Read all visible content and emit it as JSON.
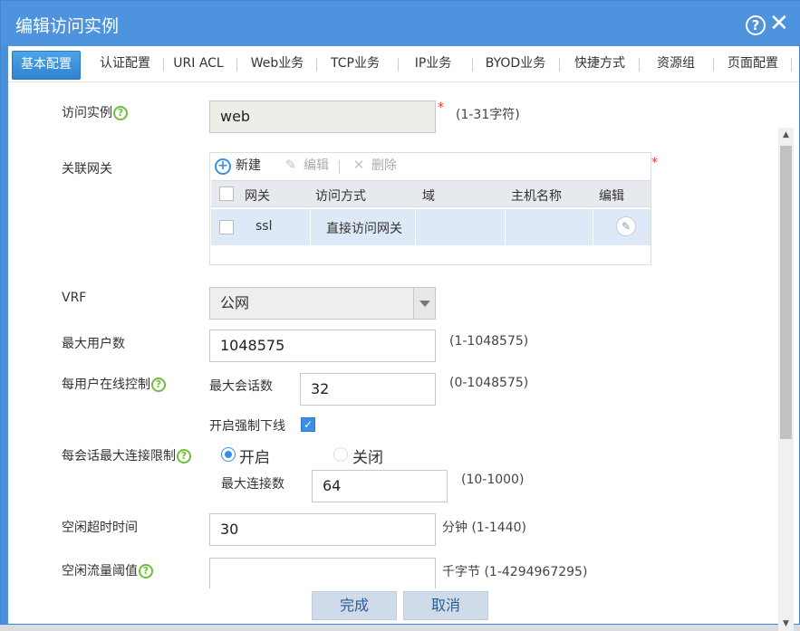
{
  "window": {
    "title": "编辑访问实例",
    "help_glyph": "?",
    "close_glyph": "✕"
  },
  "tabs": [
    {
      "label": "基本配置",
      "active": true
    },
    {
      "label": "认证配置"
    },
    {
      "label": "URI ACL"
    },
    {
      "label": "Web业务"
    },
    {
      "label": "TCP业务"
    },
    {
      "label": "IP业务"
    },
    {
      "label": "BYOD业务"
    },
    {
      "label": "快捷方式"
    },
    {
      "label": "资源组"
    },
    {
      "label": "页面配置"
    }
  ],
  "form": {
    "instance": {
      "label": "访问实例",
      "value": "web",
      "required_mark": "*",
      "hint": "(1-31字符)"
    },
    "gateway": {
      "label": "关联网关",
      "required_mark": "*",
      "toolbar": {
        "new": "新建",
        "edit": "编辑",
        "delete": "删除"
      },
      "columns": [
        "网关",
        "访问方式",
        "域",
        "主机名称",
        "编辑"
      ],
      "rows": [
        {
          "gateway": "ssl",
          "access_mode": "直接访问网关",
          "domain": "",
          "hostname": ""
        }
      ]
    },
    "vrf": {
      "label": "VRF",
      "value": "公网"
    },
    "max_users": {
      "label": "最大用户数",
      "value": "1048575",
      "hint": "(1-1048575)"
    },
    "per_user_online": {
      "label": "每用户在线控制",
      "max_sessions_label": "最大会话数",
      "max_sessions_value": "32",
      "max_sessions_hint": "(0-1048575)",
      "force_offline_label": "开启强制下线",
      "force_offline_checked": true
    },
    "per_session_limit": {
      "label": "每会话最大连接限制",
      "on_label": "开启",
      "off_label": "关闭",
      "selected": "on",
      "max_conn_label": "最大连接数",
      "max_conn_value": "64",
      "max_conn_hint": "(10-1000)"
    },
    "idle_timeout": {
      "label": "空闲超时时间",
      "value": "30",
      "unit": "分钟",
      "hint": "(1-1440)"
    },
    "idle_traffic": {
      "label": "空闲流量阈值",
      "value": "",
      "unit": "千字节",
      "hint": "(1-4294967295)"
    }
  },
  "buttons": {
    "ok": "完成",
    "cancel": "取消"
  },
  "colors": {
    "titlebar": "#4d93dd",
    "accent": "#3a8ee6",
    "help_icon": "#6fbf3a",
    "required": "#e33333"
  }
}
